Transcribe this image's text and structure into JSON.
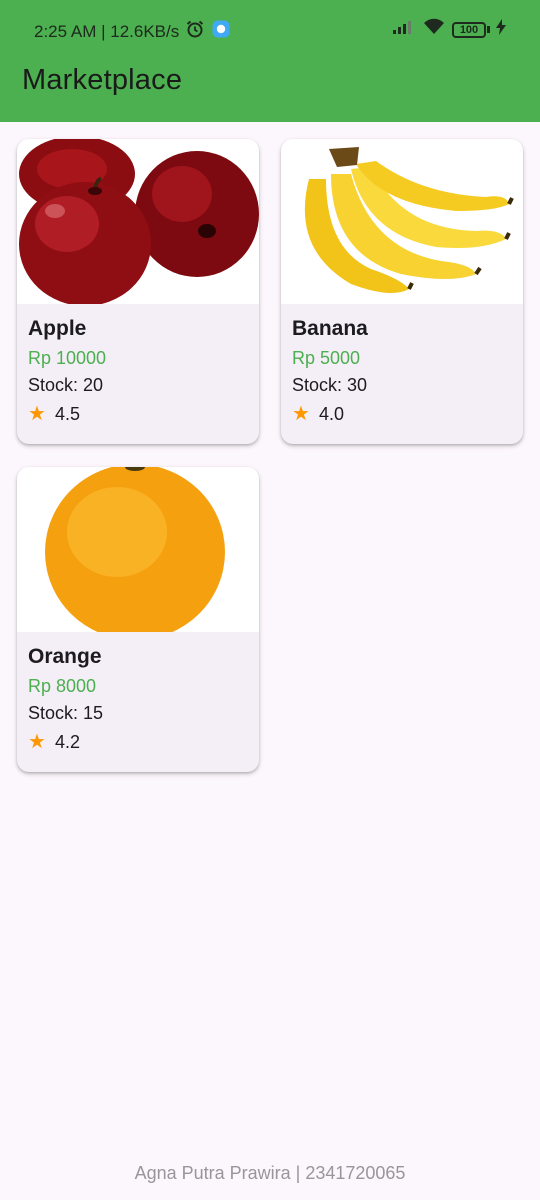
{
  "status_bar": {
    "time_speed": "2:25 AM | 12.6KB/s",
    "battery": "100",
    "icons": [
      "alarm-icon",
      "app-notification-icon",
      "signal-icon",
      "wifi-icon",
      "battery-icon",
      "charging-icon"
    ]
  },
  "app_bar": {
    "title": "Marketplace",
    "color": "#4caf50"
  },
  "products": [
    {
      "name": "Apple",
      "price": "Rp 10000",
      "stock": "Stock: 20",
      "rating": "4.5",
      "image": "apple-image"
    },
    {
      "name": "Banana",
      "price": "Rp 5000",
      "stock": "Stock: 30",
      "rating": "4.0",
      "image": "banana-image"
    },
    {
      "name": "Orange",
      "price": "Rp 8000",
      "stock": "Stock: 15",
      "rating": "4.2",
      "image": "orange-image"
    }
  ],
  "footer": "Agna Putra Prawira | 2341720065",
  "colors": {
    "price": "#4caf50",
    "star": "#ff9800",
    "background": "#fcf6fd",
    "card": "#f4eff6"
  }
}
